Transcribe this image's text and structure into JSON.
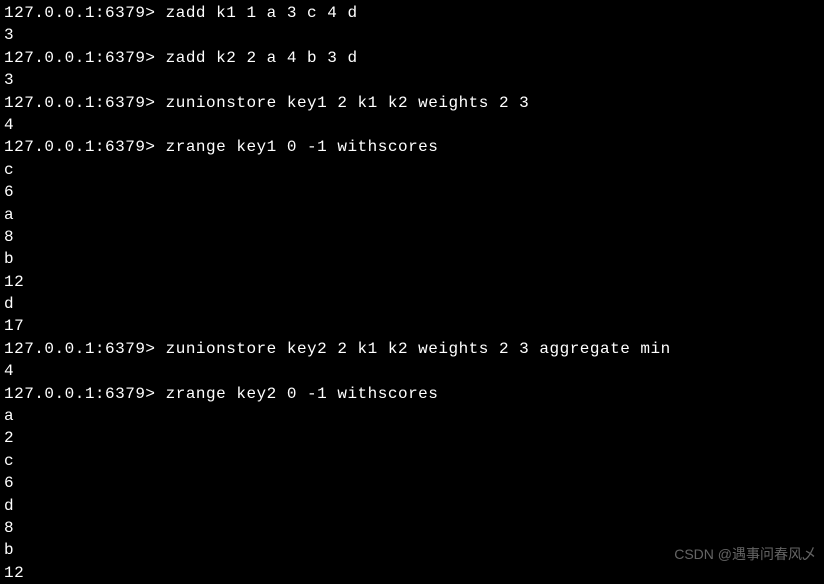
{
  "terminal": {
    "prompt": "127.0.0.1:6379>",
    "lines": [
      {
        "type": "cmd",
        "command": "zadd k1 1 a 3 c 4 d"
      },
      {
        "type": "out",
        "text": "3"
      },
      {
        "type": "cmd",
        "command": "zadd k2 2 a 4 b 3 d"
      },
      {
        "type": "out",
        "text": "3"
      },
      {
        "type": "cmd",
        "command": "zunionstore key1 2 k1 k2 weights 2 3"
      },
      {
        "type": "out",
        "text": "4"
      },
      {
        "type": "cmd",
        "command": "zrange key1 0 -1 withscores"
      },
      {
        "type": "out",
        "text": "c"
      },
      {
        "type": "out",
        "text": "6"
      },
      {
        "type": "out",
        "text": "a"
      },
      {
        "type": "out",
        "text": "8"
      },
      {
        "type": "out",
        "text": "b"
      },
      {
        "type": "out",
        "text": "12"
      },
      {
        "type": "out",
        "text": "d"
      },
      {
        "type": "out",
        "text": "17"
      },
      {
        "type": "cmd",
        "command": "zunionstore key2 2 k1 k2 weights 2 3 aggregate min"
      },
      {
        "type": "out",
        "text": "4"
      },
      {
        "type": "cmd",
        "command": "zrange key2 0 -1 withscores"
      },
      {
        "type": "out",
        "text": "a"
      },
      {
        "type": "out",
        "text": "2"
      },
      {
        "type": "out",
        "text": "c"
      },
      {
        "type": "out",
        "text": "6"
      },
      {
        "type": "out",
        "text": "d"
      },
      {
        "type": "out",
        "text": "8"
      },
      {
        "type": "out",
        "text": "b"
      },
      {
        "type": "out",
        "text": "12"
      }
    ]
  },
  "watermark": "CSDN @遇事问春风乄"
}
